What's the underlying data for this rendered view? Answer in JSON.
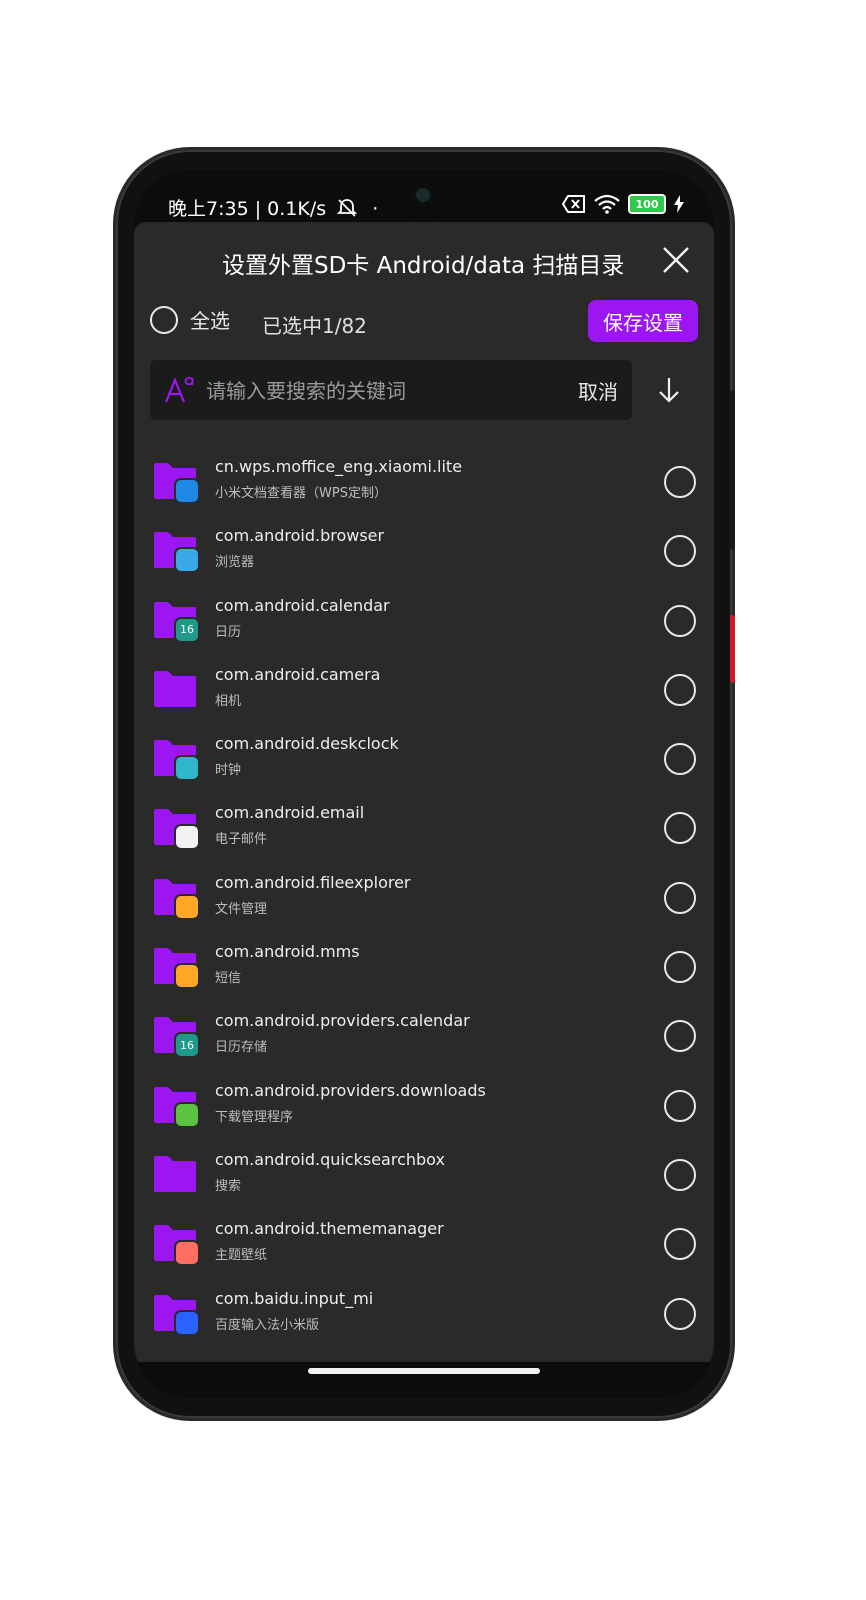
{
  "status": {
    "time": "晚上7:35",
    "speed": "0.1K/s",
    "battery": "100"
  },
  "dialog": {
    "title": "设置外置SD卡 Android/data 扫描目录",
    "select_all": "全选",
    "selected_count": "已选中1/82",
    "save_label": "保存设置",
    "search_placeholder": "请输入要搜索的关键词",
    "cancel_label": "取消"
  },
  "items": [
    {
      "package": "cn.wps.moffice_eng.xiaomi.lite",
      "name": "小米文档查看器（WPS定制）",
      "icon": "wps-doc-icon",
      "color": "#1e88e5"
    },
    {
      "package": "com.android.browser",
      "name": "浏览器",
      "icon": "browser-icon",
      "color": "#3aa8e8"
    },
    {
      "package": "com.android.calendar",
      "name": "日历",
      "icon": "calendar-icon",
      "color": "#1f9a8a"
    },
    {
      "package": "com.android.camera",
      "name": "相机",
      "icon": "",
      "color": ""
    },
    {
      "package": "com.android.deskclock",
      "name": "时钟",
      "icon": "clock-icon",
      "color": "#2fb7c9"
    },
    {
      "package": "com.android.email",
      "name": "电子邮件",
      "icon": "email-icon",
      "color": "#f2f2f2"
    },
    {
      "package": "com.android.fileexplorer",
      "name": "文件管理",
      "icon": "file-manager-icon",
      "color": "#ffa726"
    },
    {
      "package": "com.android.mms",
      "name": "短信",
      "icon": "sms-icon",
      "color": "#ffa726"
    },
    {
      "package": "com.android.providers.calendar",
      "name": "日历存储",
      "icon": "calendar-icon",
      "color": "#1f9a8a"
    },
    {
      "package": "com.android.providers.downloads",
      "name": "下载管理程序",
      "icon": "download-icon",
      "color": "#5cc241"
    },
    {
      "package": "com.android.quicksearchbox",
      "name": "搜索",
      "icon": "",
      "color": ""
    },
    {
      "package": "com.android.thememanager",
      "name": "主题壁纸",
      "icon": "theme-icon",
      "color": "#ff6f61"
    },
    {
      "package": "com.baidu.input_mi",
      "name": "百度输入法小米版",
      "icon": "baidu-input-icon",
      "color": "#2962ff"
    }
  ],
  "badge_text": {
    "calendar-icon": "16"
  },
  "colors": {
    "accent": "#9b16f0",
    "folder": "#9b16f0",
    "sheet_bg": "#2a2a2a",
    "search_bg": "#1b1b1b"
  }
}
